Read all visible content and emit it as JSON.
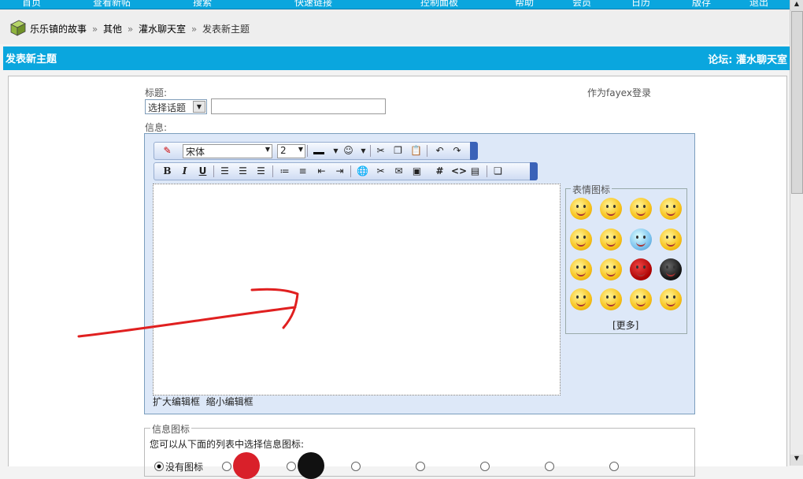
{
  "nav": {
    "items": [
      "首页",
      "查看新帖",
      "搜索",
      "快速链接",
      "控制面板",
      "帮助",
      "会员",
      "日历",
      "版存",
      "退出"
    ]
  },
  "breadcrumb": {
    "site": "乐乐镇的故事",
    "c1": "其他",
    "c2": "灌水聊天室",
    "current": "发表新主题"
  },
  "section": {
    "title": "发表新主题",
    "forum": "论坛: 灌水聊天室"
  },
  "form": {
    "title_label": "标题:",
    "topic_select": "选择话题",
    "message_label": "信息:",
    "login_as": "作为fayex登录"
  },
  "toolbar": {
    "font": "宋体",
    "size": "2"
  },
  "smilies": {
    "legend": "表情图标",
    "more": "[更多]",
    "faces": [
      "grin",
      "surprised",
      "text",
      "cry",
      "smile",
      "worried",
      "blue",
      "sad",
      "smug",
      "sleepy",
      "spider",
      "cool",
      "sleep",
      "book",
      "frown",
      "grin2"
    ]
  },
  "editor": {
    "enlarge": "扩大编辑框",
    "shrink": "缩小编辑框"
  },
  "info_icon": {
    "legend": "信息图标",
    "desc": "您可以从下面的列表中选择信息图标:",
    "none": "没有图标"
  },
  "colors": {
    "accent": "#0aa6de",
    "annotation_arrow": "#e02020"
  }
}
